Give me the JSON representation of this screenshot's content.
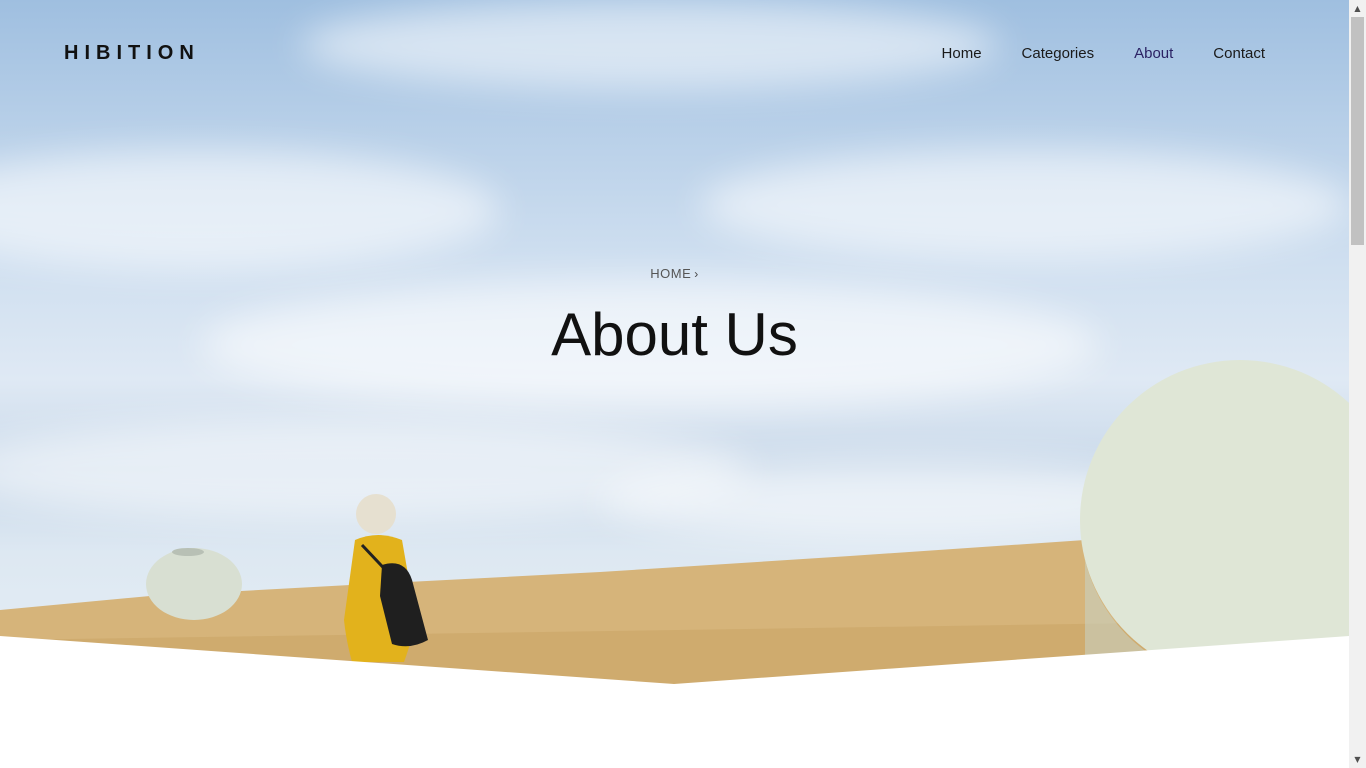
{
  "brand": {
    "name": "HIBITION"
  },
  "nav": {
    "items": [
      {
        "label": "Home",
        "active": false
      },
      {
        "label": "Categories",
        "active": false
      },
      {
        "label": "About",
        "active": true
      },
      {
        "label": "Contact",
        "active": false
      }
    ]
  },
  "hero": {
    "breadcrumb": "HOME",
    "breadcrumb_icon": "chevron-right-icon",
    "title": "About Us"
  },
  "colors": {
    "active_nav": "#2b2264",
    "text": "#111111",
    "field": "#d9b67a",
    "dress": "#e2b21c"
  }
}
